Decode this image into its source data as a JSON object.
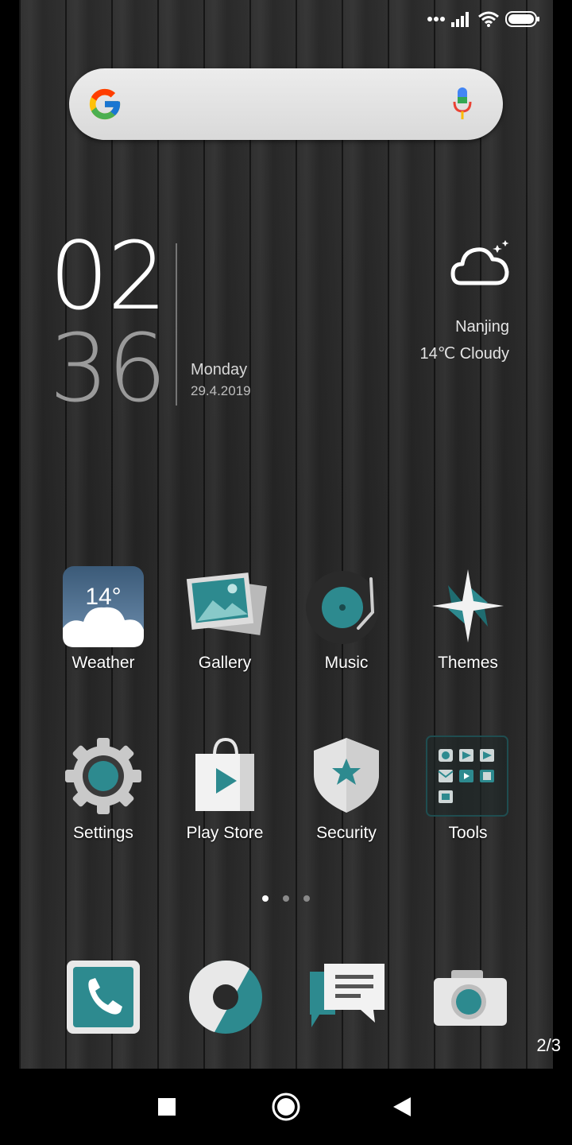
{
  "status_bar": {
    "icons": [
      "more-dots-icon",
      "signal-icon",
      "wifi-icon",
      "battery-icon"
    ]
  },
  "search": {
    "provider": "Google",
    "icons": [
      "google-logo-icon",
      "microphone-icon"
    ]
  },
  "clock": {
    "hours": "02",
    "minutes": "36",
    "day": "Monday",
    "date": "29.4.2019"
  },
  "weather_widget": {
    "city": "Nanjing",
    "condition": "14℃ Cloudy",
    "icon": "cloudy-night-icon"
  },
  "apps": [
    {
      "label": "Weather",
      "icon_text": "14°"
    },
    {
      "label": "Gallery"
    },
    {
      "label": "Music"
    },
    {
      "label": "Themes"
    },
    {
      "label": "Settings"
    },
    {
      "label": "Play Store"
    },
    {
      "label": "Security"
    },
    {
      "label": "Tools"
    }
  ],
  "page_dots": {
    "count": 3,
    "active": 1
  },
  "dock": [
    "phone-icon",
    "browser-icon",
    "messages-icon",
    "camera-icon"
  ],
  "page_indicator": "2/3",
  "nav_bar": {
    "buttons": [
      "recents-button",
      "home-button",
      "back-button"
    ]
  },
  "colors": {
    "accent": "#2d8a8f",
    "accent_dark": "#1f6c70",
    "wallpaper": "#2a2a2a"
  }
}
